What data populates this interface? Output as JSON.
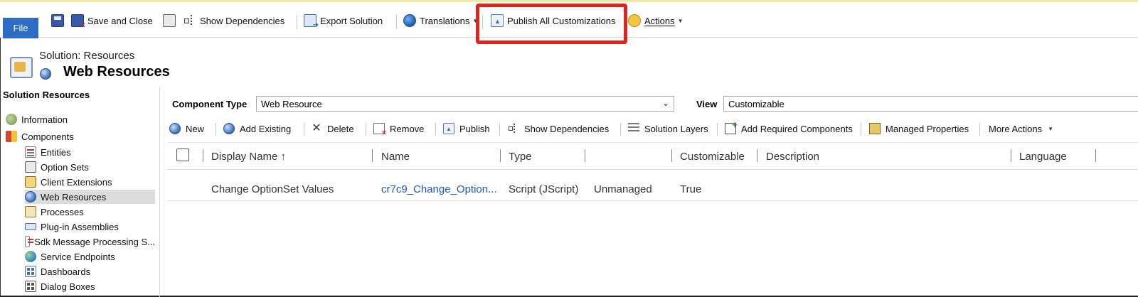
{
  "ribbon": {
    "file_label": "File",
    "save_and_close": "Save and Close",
    "show_dependencies": "Show Dependencies",
    "export_solution": "Export Solution",
    "translations": "Translations",
    "publish_all": "Publish All Customizations",
    "actions": "Actions"
  },
  "header": {
    "solution_label": "Solution: Resources",
    "page_title": "Web Resources"
  },
  "nav": {
    "heading": "Solution Resources",
    "items": [
      {
        "label": "Information"
      },
      {
        "label": "Components"
      },
      {
        "label": "Entities"
      },
      {
        "label": "Option Sets"
      },
      {
        "label": "Client Extensions"
      },
      {
        "label": "Web Resources"
      },
      {
        "label": "Processes"
      },
      {
        "label": "Plug-in Assemblies"
      },
      {
        "label": "Sdk Message Processing S..."
      },
      {
        "label": "Service Endpoints"
      },
      {
        "label": "Dashboards"
      },
      {
        "label": "Dialog Boxes"
      }
    ],
    "selected": "Web Resources"
  },
  "filters": {
    "component_type_label": "Component Type",
    "component_type_value": "Web Resource",
    "view_label": "View",
    "view_value": "Customizable"
  },
  "toolbar": {
    "new": "New",
    "add_existing": "Add Existing",
    "delete": "Delete",
    "remove": "Remove",
    "publish": "Publish",
    "show_dependencies": "Show Dependencies",
    "solution_layers": "Solution Layers",
    "add_required": "Add Required Components",
    "managed_properties": "Managed Properties",
    "more_actions": "More Actions"
  },
  "grid": {
    "columns": [
      "Display Name ↑",
      "Name",
      "Type",
      "",
      "Customizable",
      "Description",
      "Language"
    ],
    "rows": [
      [
        "Change OptionSet Values",
        "cr7c9_Change_Option...",
        "Script (JScript)",
        "Unmanaged",
        "True",
        "",
        ""
      ]
    ]
  },
  "colors": {
    "file_button": "#2d6bc4",
    "highlight_border": "#e0231b",
    "link": "#1a5cb8"
  }
}
